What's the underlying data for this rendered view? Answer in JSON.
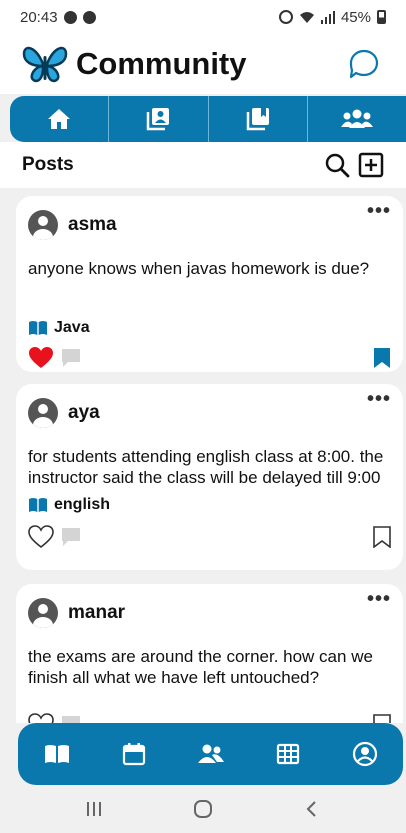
{
  "status_bar": {
    "time": "20:43",
    "battery_text": "45%"
  },
  "header": {
    "title": "Community"
  },
  "top_tabs": [
    {
      "icon": "home-icon"
    },
    {
      "icon": "contacts-icon"
    },
    {
      "icon": "library-icon"
    },
    {
      "icon": "group-icon"
    }
  ],
  "posts_bar": {
    "title": "Posts"
  },
  "posts": [
    {
      "author": "asma",
      "text": "anyone knows when javas homework is due?",
      "tag": "Java",
      "liked": true,
      "bookmarked": true
    },
    {
      "author": "aya",
      "text": "for students attending english class at 8:00. the instructor said the class will be delayed till 9:00",
      "tag": "english",
      "liked": false,
      "bookmarked": false
    },
    {
      "author": "manar",
      "text": "the exams are around the corner. how can we finish all what we have left untouched?",
      "tag": "",
      "liked": false,
      "bookmarked": false
    }
  ],
  "bottom_nav": [
    {
      "icon": "book-icon"
    },
    {
      "icon": "calendar-icon"
    },
    {
      "icon": "people-icon"
    },
    {
      "icon": "table-icon"
    },
    {
      "icon": "account-icon"
    }
  ],
  "colors": {
    "primary": "#0a78ad",
    "like": "#e8121e",
    "background": "#f0f0f0"
  }
}
